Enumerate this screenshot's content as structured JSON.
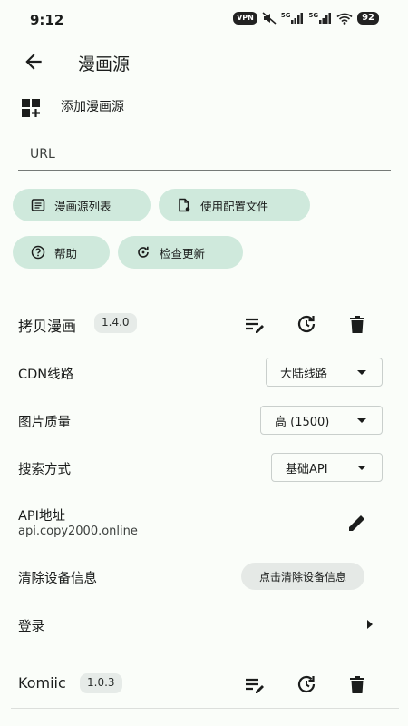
{
  "status": {
    "time": "9:12",
    "vpn": "VPN",
    "net1": "5G",
    "net2": "5G",
    "battery": "92"
  },
  "appbar": {
    "title": "漫画源"
  },
  "add_source": {
    "label": "添加漫画源"
  },
  "url_input": {
    "placeholder": "URL",
    "value": ""
  },
  "chips": {
    "list": "漫画源列表",
    "config": "使用配置文件",
    "help": "帮助",
    "check_update": "检查更新"
  },
  "sources": [
    {
      "name": "拷贝漫画",
      "version": "1.4.0",
      "settings": {
        "cdn_label": "CDN线路",
        "cdn_value": "大陆线路",
        "quality_label": "图片质量",
        "quality_value": "高 (1500)",
        "search_label": "搜索方式",
        "search_value": "基础API",
        "api_label": "API地址",
        "api_value": "api.copy2000.online",
        "clear_label": "清除设备信息",
        "clear_button": "点击清除设备信息",
        "login_label": "登录"
      }
    },
    {
      "name": "Komiic",
      "version": "1.0.3"
    }
  ],
  "colors": {
    "chip_bg": "#cfe9dc",
    "background": "#fafdf9",
    "text": "#1b1d1c"
  },
  "icons": [
    "back-arrow-icon",
    "add-grid-icon",
    "list-icon",
    "file-settings-icon",
    "help-icon",
    "refresh-icon",
    "edit-list-icon",
    "update-icon",
    "delete-icon",
    "pencil-icon",
    "play-arrow-icon"
  ]
}
